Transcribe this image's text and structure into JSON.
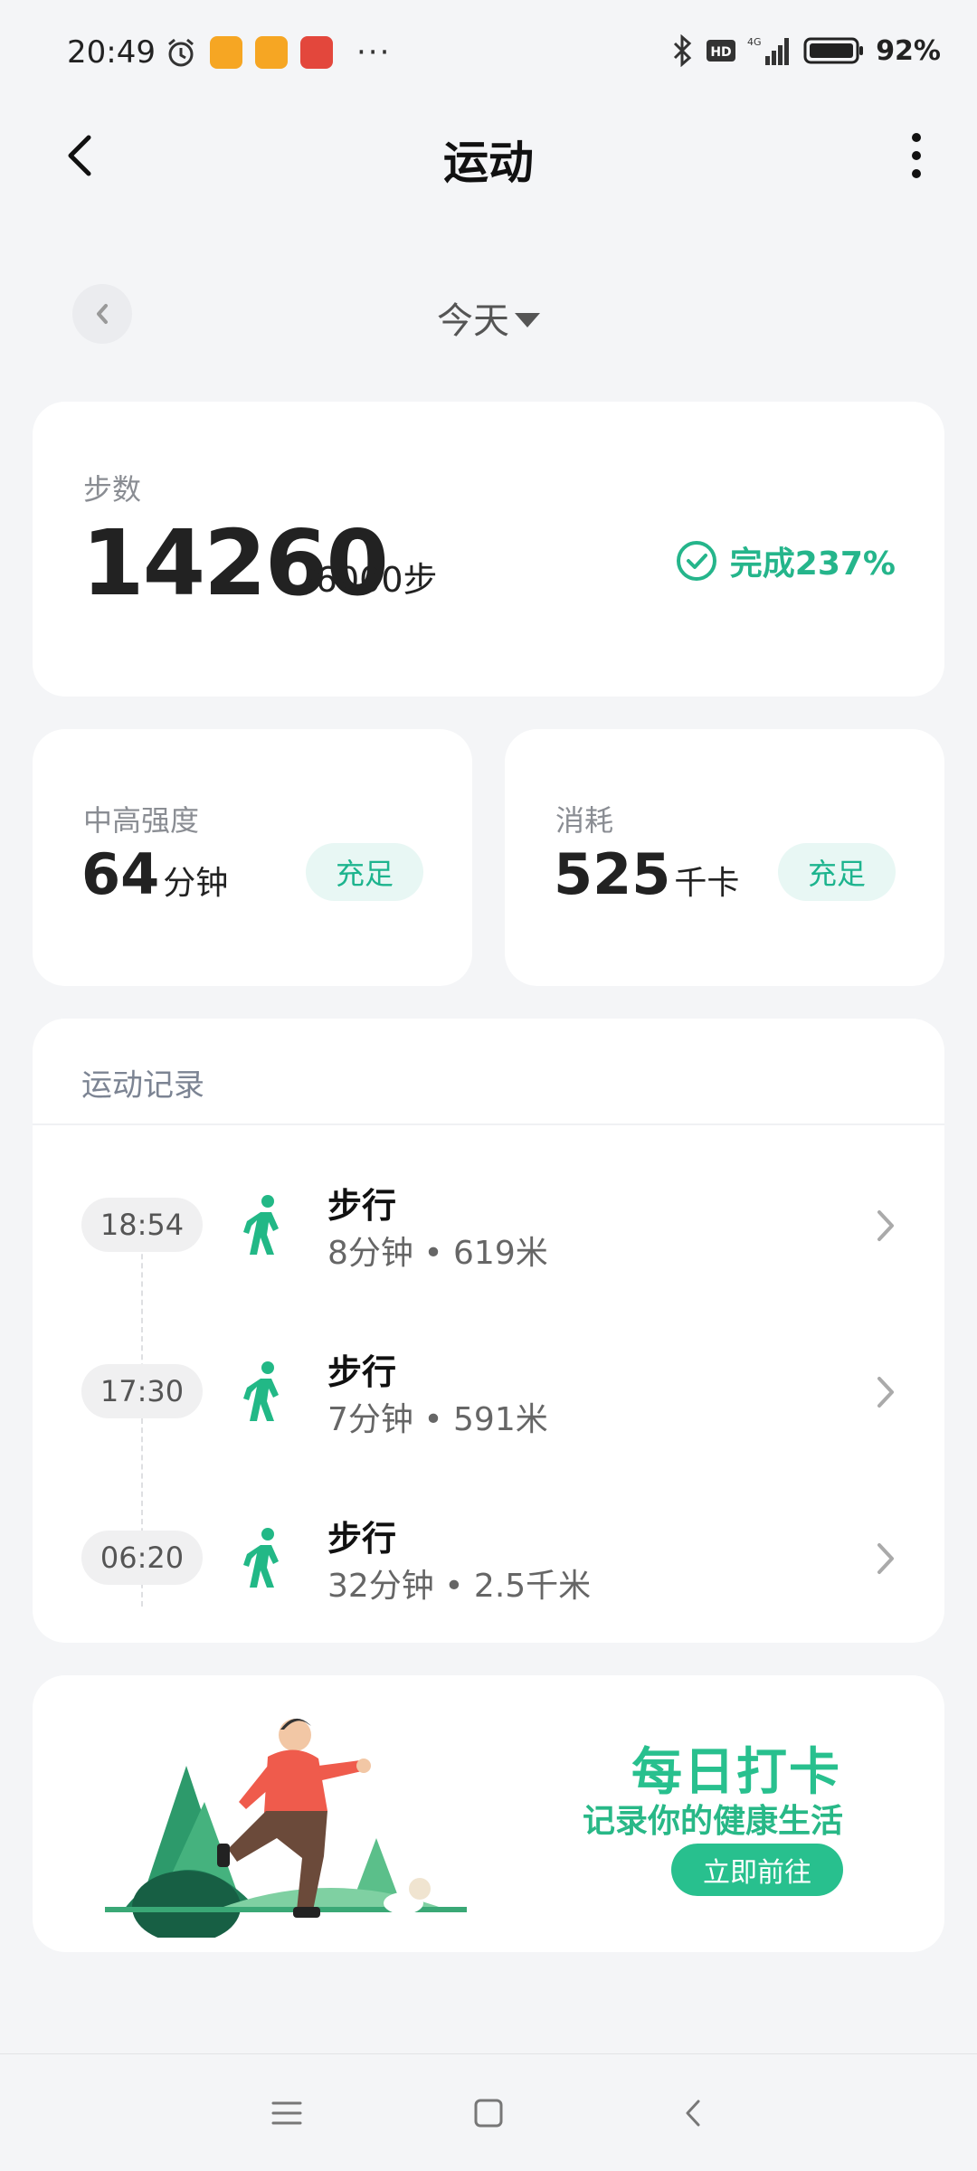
{
  "status_bar": {
    "time": "20:49",
    "more": "···",
    "battery_percent": "92%"
  },
  "header": {
    "title": "运动"
  },
  "date": {
    "label": "今天"
  },
  "steps": {
    "label": "步数",
    "value": "14260",
    "goal": "/6000步",
    "complete": "完成237%"
  },
  "intensity": {
    "label": "中高强度",
    "value": "64",
    "unit": "分钟",
    "badge": "充足"
  },
  "calories": {
    "label": "消耗",
    "value": "525",
    "unit": "千卡",
    "badge": "充足"
  },
  "records": {
    "title": "运动记录",
    "items": [
      {
        "time": "18:54",
        "name": "步行",
        "detail": "8分钟 • 619米"
      },
      {
        "time": "17:30",
        "name": "步行",
        "detail": "7分钟 • 591米"
      },
      {
        "time": "06:20",
        "name": "步行",
        "detail": "32分钟 • 2.5千米"
      }
    ]
  },
  "banner": {
    "title": "每日打卡",
    "subtitle": "记录你的健康生活",
    "button": "立即前往"
  },
  "colors": {
    "accent": "#25b58b",
    "background": "#f4f5f7",
    "card": "#ffffff"
  }
}
